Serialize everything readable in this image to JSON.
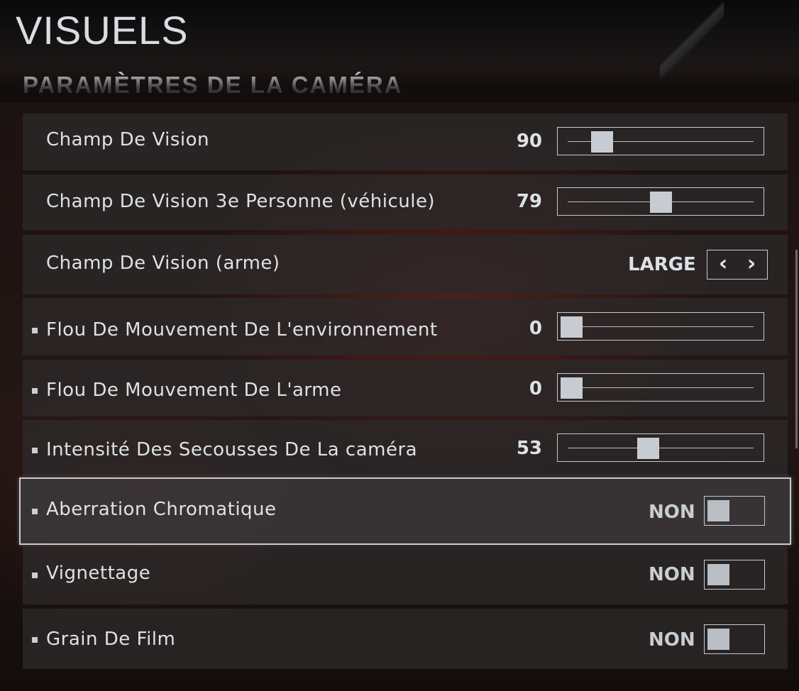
{
  "page_title": "VISUELS",
  "section_title": "PARAMÈTRES DE LA CAMÉRA",
  "settings": [
    {
      "label": "Champ De Vision",
      "control": "slider",
      "value": "90",
      "level": 0.17,
      "bullet": false
    },
    {
      "label": "Champ De Vision 3e Personne (véhicule)",
      "control": "slider",
      "value": "79",
      "level": 0.5,
      "bullet": false
    },
    {
      "label": "Champ De Vision (arme)",
      "control": "selector",
      "value": "LARGE",
      "bullet": false
    },
    {
      "label": "Flou De Mouvement De L'environnement",
      "control": "slider",
      "value": "0",
      "level": 0.0,
      "bullet": true
    },
    {
      "label": "Flou De Mouvement De L'arme",
      "control": "slider",
      "value": "0",
      "level": 0.0,
      "bullet": true
    },
    {
      "label": "Intensité Des Secousses De La caméra",
      "control": "slider",
      "value": "53",
      "level": 0.43,
      "bullet": true
    },
    {
      "label": "Aberration Chromatique",
      "control": "toggle",
      "value": "NON",
      "bullet": true,
      "selected": true
    },
    {
      "label": "Vignettage",
      "control": "toggle",
      "value": "NON",
      "bullet": true
    },
    {
      "label": "Grain De Film",
      "control": "toggle",
      "value": "NON",
      "bullet": true
    }
  ],
  "icons": {
    "prev": "chevron-left-icon",
    "next": "chevron-right-icon"
  },
  "colors": {
    "accent": "#c7ccd2",
    "row_bg": "#2c2828",
    "text": "#dde1e6"
  }
}
